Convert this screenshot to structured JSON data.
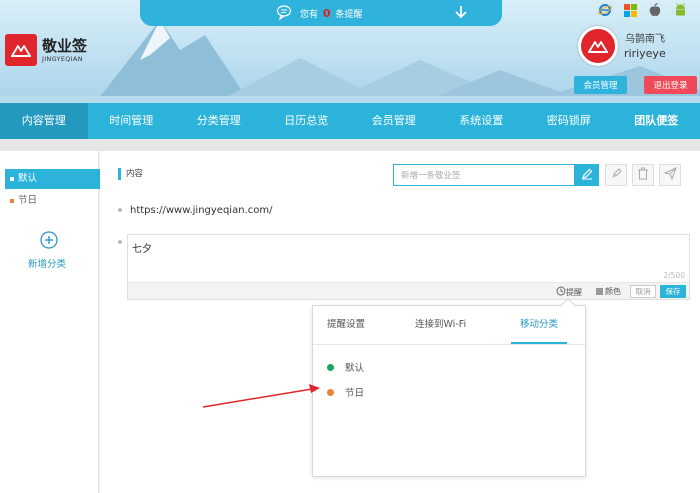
{
  "header": {
    "logo_cn": "敬业签",
    "logo_en": "JINGYEQIAN",
    "notice_prefix": "您有",
    "notice_count": "0",
    "notice_suffix": "条提醒",
    "user_name": "乌鹊南飞",
    "user_id": "ririyeye",
    "member_button": "会员管理",
    "logout_button": "退出登录",
    "os_icons": [
      "ie-icon",
      "windows-icon",
      "apple-icon",
      "android-icon"
    ]
  },
  "nav": {
    "items": [
      "内容管理",
      "时间管理",
      "分类管理",
      "日历总览",
      "会员管理",
      "系统设置",
      "密码锁屏",
      "团队便签"
    ],
    "active_index": 0
  },
  "sidebar": {
    "categories": [
      {
        "label": "默认",
        "color": "#2bb3da"
      },
      {
        "label": "节日",
        "color": "#f08030"
      }
    ],
    "add_label": "新增分类"
  },
  "main": {
    "section_label": "内容",
    "new_note_placeholder": "新增一条敬业签",
    "url_text": "https://www.jingyeqian.com/",
    "editor_text": "七夕",
    "counter": "2/500",
    "remind_label": "提醒",
    "color_label": "颜色",
    "cancel_label": "取消",
    "save_label": "保存"
  },
  "popup": {
    "tabs": [
      "提醒设置",
      "连接到Wi-Fi",
      "移动分类"
    ],
    "active_tab": 2,
    "items": [
      {
        "label": "默认",
        "color": "#1aa860"
      },
      {
        "label": "节日",
        "color": "#f08030"
      }
    ]
  },
  "colors": {
    "accent": "#2bb3da",
    "brand_red": "#e0262c",
    "logout": "#f04a5a"
  }
}
